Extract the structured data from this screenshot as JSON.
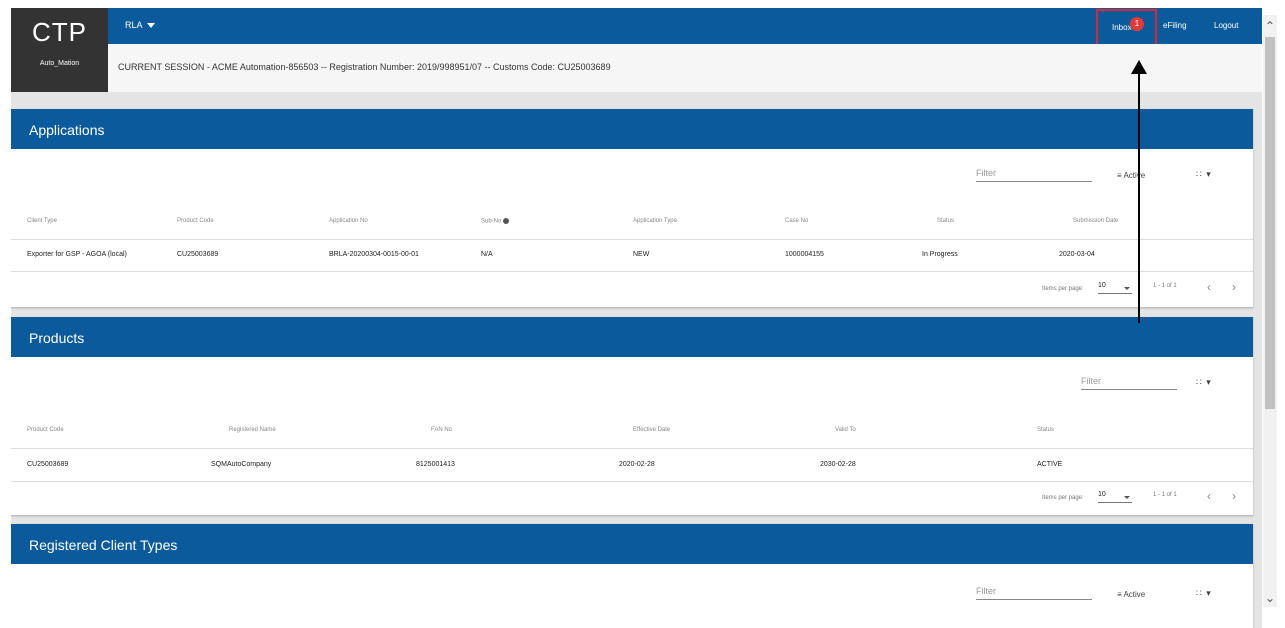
{
  "app": {
    "logo": "CTP",
    "user": "Auto_Mation",
    "menu": "RLA",
    "session": "CURRENT SESSION - ACME Automation-856503 -- Registration Number: 2019/998951/07 -- Customs Code: CU25003689"
  },
  "nav": {
    "inbox": "Inbox",
    "inbox_badge": "1",
    "efiling": "eFiling",
    "logout": "Logout"
  },
  "icons": {
    "menu_caret": "caret-down-icon",
    "filter": "filter-icon",
    "grid": "grid-icon",
    "info": "info-icon",
    "annotation": "up-arrow-icon"
  },
  "colors": {
    "brand": "#0a5a9c",
    "logo_bg": "#333333",
    "badge": "#e53935",
    "highlight": "#d9282f"
  },
  "applications": {
    "title": "Applications",
    "filter_placeholder": "Filter",
    "active_label": "Active",
    "grid_label": "∷ ▾",
    "columns": [
      "Client Type",
      "Product Code",
      "Application No",
      "Sub-No",
      "Application Type",
      "Case No",
      "Status",
      "Submission Date"
    ],
    "rows": [
      [
        "Exporter for GSP - AGOA (local)",
        "CU25003689",
        "BRLA-20200304-0015-00-01",
        "N/A",
        "NEW",
        "1000004155",
        "In Progress",
        "2020-03-04"
      ]
    ],
    "items_per_page_label": "Items per page:",
    "items_per_page": "10",
    "range": "1 - 1 of 1"
  },
  "products": {
    "title": "Products",
    "filter_placeholder": "Filter",
    "grid_label": "∷ ▾",
    "columns": [
      "Product Code",
      "Registered Name",
      "FAN No",
      "Effective Date",
      "Valid To",
      "Status"
    ],
    "rows": [
      [
        "CU25003689",
        "SQMAutoCompany",
        "8125001413",
        "2020-02-28",
        "2030-02-28",
        "ACTIVE"
      ]
    ],
    "items_per_page_label": "Items per page:",
    "items_per_page": "10",
    "range": "1 - 1 of 1"
  },
  "registered_client_types": {
    "title": "Registered Client Types",
    "filter_placeholder": "Filter",
    "active_label": "Active",
    "grid_label": "∷ ▾"
  }
}
